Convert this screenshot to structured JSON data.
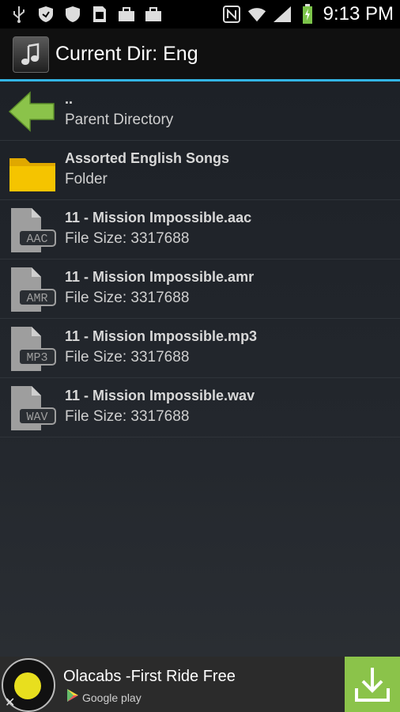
{
  "status_bar": {
    "time": "9:13 PM",
    "icons": [
      "usb-icon",
      "shield-icon",
      "shield-icon",
      "sdcard-icon",
      "bag-icon",
      "bag-icon",
      "nfc-icon",
      "wifi-icon",
      "signal-icon",
      "battery-icon"
    ]
  },
  "action_bar": {
    "title": "Current Dir: Eng",
    "app_icon": "music-note-icon"
  },
  "list": {
    "rows": [
      {
        "title": "..",
        "subtitle": "Parent Directory",
        "icon": "back-arrow-icon"
      },
      {
        "title": "Assorted English Songs",
        "subtitle": "Folder",
        "icon": "folder-icon"
      },
      {
        "title": "11 - Mission Impossible.aac",
        "subtitle": "File Size: 3317688",
        "icon": "file-icon",
        "ext": "AAC"
      },
      {
        "title": "11 - Mission Impossible.amr",
        "subtitle": "File Size: 3317688",
        "icon": "file-icon",
        "ext": "AMR"
      },
      {
        "title": "11 - Mission Impossible.mp3",
        "subtitle": "File Size: 3317688",
        "icon": "file-icon",
        "ext": "MP3"
      },
      {
        "title": "11 - Mission Impossible.wav",
        "subtitle": "File Size: 3317688",
        "icon": "file-icon",
        "ext": "WAV"
      }
    ]
  },
  "ad": {
    "title": "Olacabs -First Ride Free",
    "store_label": "Google play",
    "close": "✕"
  },
  "colors": {
    "accent": "#33b5e5",
    "folder": "#f5c400",
    "arrow": "#8bc34a",
    "download": "#8bc34a"
  }
}
